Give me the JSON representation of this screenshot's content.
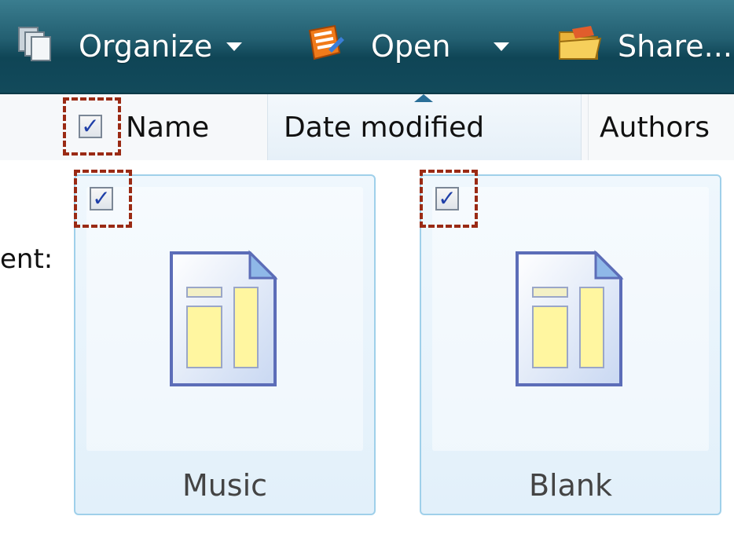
{
  "toolbar": {
    "organize_label": "Organize",
    "open_label": "Open",
    "share_label": "Share..."
  },
  "columns": {
    "name": "Name",
    "date_modified": "Date modified",
    "authors": "Authors"
  },
  "side_text": "ent:",
  "items": [
    {
      "label": "Music",
      "checked": true
    },
    {
      "label": "Blank",
      "checked": true
    }
  ],
  "colors": {
    "toolbar_top": "#3a7d8f",
    "toolbar_bottom": "#124a5b",
    "highlight_dash": "#9a2a14",
    "tile_border": "#9fd0ea",
    "check": "#1f3fa8"
  }
}
